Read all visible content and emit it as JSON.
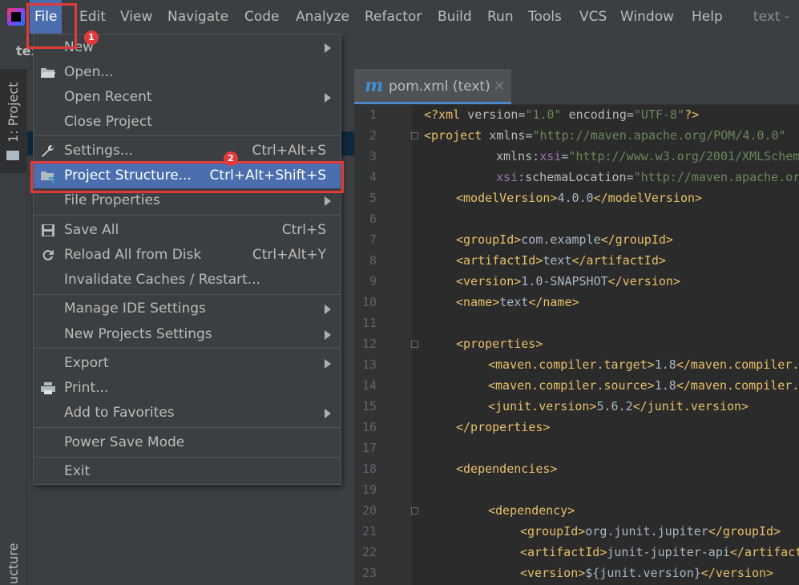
{
  "menubar": {
    "items": [
      "File",
      "Edit",
      "View",
      "Navigate",
      "Code",
      "Analyze",
      "Refactor",
      "Build",
      "Run",
      "Tools",
      "VCS",
      "Window",
      "Help"
    ],
    "window_title": "text -"
  },
  "navbar": {
    "crumb": "tex"
  },
  "tool_strip": {
    "project_tab": "1: Project",
    "structure_tab": "ucture"
  },
  "editor": {
    "tab_label": "pom.xml (text)",
    "tab_close": "×",
    "tab_icon": "m",
    "line_numbers": [
      "1",
      "2",
      "3",
      "4",
      "5",
      "6",
      "7",
      "8",
      "9",
      "10",
      "11",
      "12",
      "13",
      "14",
      "15",
      "16",
      "17",
      "18",
      "19",
      "20",
      "21",
      "22",
      "23"
    ]
  },
  "file_menu": {
    "items": {
      "new": "New",
      "open": "Open...",
      "open_recent": "Open Recent",
      "close_project": "Close Project",
      "settings": "Settings...",
      "settings_sc": "Ctrl+Alt+S",
      "project_structure": "Project Structure...",
      "project_structure_sc": "Ctrl+Alt+Shift+S",
      "file_properties": "File Properties",
      "save_all": "Save All",
      "save_all_sc": "Ctrl+S",
      "reload": "Reload All from Disk",
      "reload_sc": "Ctrl+Alt+Y",
      "invalidate": "Invalidate Caches / Restart...",
      "manage_ide": "Manage IDE Settings",
      "new_projects_settings": "New Projects Settings",
      "export": "Export",
      "print": "Print...",
      "add_favorites": "Add to Favorites",
      "power_save": "Power Save Mode",
      "exit": "Exit"
    }
  },
  "annotations": {
    "badge1": "1",
    "badge2": "2"
  },
  "colors": {
    "accent": "#4b6eaf",
    "annotation": "#e03a3a",
    "background": "#2b2b2b"
  }
}
